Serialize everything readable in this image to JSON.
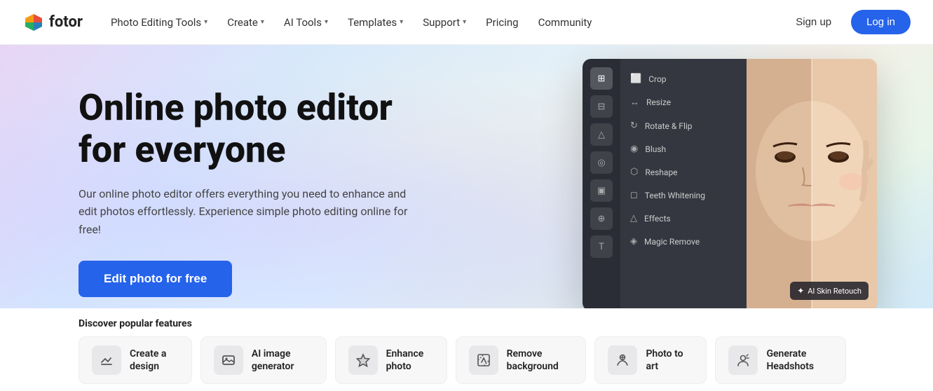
{
  "brand": {
    "logo_text": "fotor",
    "logo_icon": "🎨"
  },
  "navbar": {
    "items": [
      {
        "label": "Photo Editing Tools",
        "has_dropdown": true
      },
      {
        "label": "Create",
        "has_dropdown": true
      },
      {
        "label": "AI Tools",
        "has_dropdown": true
      },
      {
        "label": "Templates",
        "has_dropdown": true
      },
      {
        "label": "Support",
        "has_dropdown": true
      },
      {
        "label": "Pricing",
        "has_dropdown": false
      },
      {
        "label": "Community",
        "has_dropdown": false
      }
    ],
    "signup_label": "Sign up",
    "login_label": "Log in"
  },
  "hero": {
    "title": "Online photo editor for everyone",
    "subtitle": "Our online photo editor offers everything you need to enhance and edit photos effortlessly. Experience simple photo editing online for free!",
    "cta_label": "Edit photo for free",
    "editor": {
      "menu_items": [
        "Crop",
        "Resize",
        "Rotate & Flip",
        "Blush",
        "Reshape",
        "Teeth Whitening",
        "Effects",
        "Magic Remove"
      ],
      "ai_badge": "AI Skin Retouch"
    }
  },
  "features": {
    "title": "Discover popular features",
    "cards": [
      {
        "icon": "✂️",
        "label": "Create a design"
      },
      {
        "icon": "🖼️",
        "label": "AI image generator"
      },
      {
        "icon": "✨",
        "label": "Enhance photo"
      },
      {
        "icon": "🔲",
        "label": "Remove background"
      },
      {
        "icon": "🎨",
        "label": "Photo to art"
      },
      {
        "icon": "👤",
        "label": "Generate Headshots"
      }
    ]
  }
}
